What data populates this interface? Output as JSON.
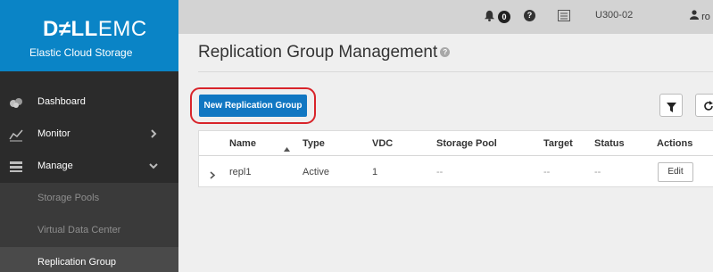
{
  "brand": {
    "logo_dell": "D≠LL",
    "logo_emc": "EMC",
    "product": "Elastic Cloud Storage"
  },
  "topbar": {
    "alerts_count": "0",
    "device": "U300-02",
    "user": "ro"
  },
  "sidebar": {
    "items": [
      {
        "label": "Dashboard",
        "icon": "dashboard-icon"
      },
      {
        "label": "Monitor",
        "icon": "monitor-chart-icon",
        "chevron": "chevron-right-icon"
      },
      {
        "label": "Manage",
        "icon": "manage-icon",
        "chevron": "chevron-down-icon"
      }
    ],
    "sub_items": [
      {
        "label": "Storage Pools"
      },
      {
        "label": "Virtual Data Center"
      },
      {
        "label": "Replication Group",
        "active": true
      }
    ]
  },
  "page": {
    "title": "Replication Group Management",
    "new_button": "New Replication Group"
  },
  "table": {
    "columns": [
      "Name",
      "Type",
      "VDC",
      "Storage Pool",
      "Target",
      "Status",
      "Actions"
    ],
    "rows": [
      {
        "name": "repl1",
        "type": "Active",
        "vdc": "1",
        "storage_pool": "--",
        "target": "--",
        "status": "--",
        "action": "Edit"
      }
    ]
  },
  "colors": {
    "brand_blue": "#0a84c6",
    "primary_button": "#1177c2",
    "highlight_ring": "#d8242a",
    "sidebar_bg": "#2b2b2b"
  }
}
